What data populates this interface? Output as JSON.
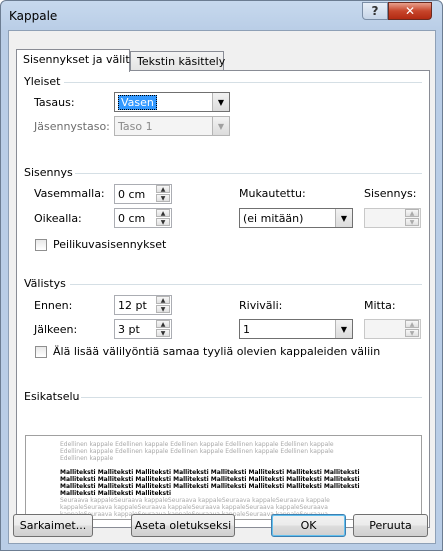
{
  "window": {
    "title": "Kappale"
  },
  "titlebar": {
    "help": "?",
    "close": "✕"
  },
  "tabs": [
    {
      "label": "Sisennykset ja välit",
      "active": true
    },
    {
      "label": "Tekstin käsittely",
      "active": false
    }
  ],
  "general": {
    "heading": "Yleiset",
    "alignment_label": "Tasaus:",
    "alignment_value": "Vasen",
    "outline_label": "Jäsennystaso:",
    "outline_value": "Taso 1"
  },
  "indent": {
    "heading": "Sisennys",
    "left_label": "Vasemmalla:",
    "left_value": "0 cm",
    "right_label": "Oikealla:",
    "right_value": "0 cm",
    "special_label": "Mukautettu:",
    "special_value": "(ei mitään)",
    "by_label": "Sisennys:",
    "by_value": "",
    "mirror_label": "Peilikuvasisennykset"
  },
  "spacing": {
    "heading": "Välistys",
    "before_label": "Ennen:",
    "before_value": "12 pt",
    "after_label": "Jälkeen:",
    "after_value": "3 pt",
    "line_label": "Riviväli:",
    "line_value": "1",
    "at_label": "Mitta:",
    "at_value": "",
    "nospace_label": "Älä lisää välilyöntiä samaa tyyliä olevien kappaleiden väliin"
  },
  "preview": {
    "heading": "Esikatselu",
    "prev_lines": [
      "Edellinen kappale Edellinen kappale Edellinen kappale Edellinen kappale Edellinen kappale",
      "Edellinen kappale Edellinen kappale Edellinen kappale Edellinen kappale Edellinen kappale",
      "Edellinen kappale"
    ],
    "sample_lines": [
      "Malliteksti Malliteksti Malliteksti Malliteksti Malliteksti Malliteksti Malliteksti Malliteksti",
      "Malliteksti Malliteksti Malliteksti Malliteksti Malliteksti Malliteksti Malliteksti Malliteksti",
      "Malliteksti Malliteksti Malliteksti Malliteksti Malliteksti Malliteksti Malliteksti Malliteksti",
      "Malliteksti Malliteksti Malliteksti"
    ],
    "next_lines": [
      "Seuraava kappaleSeuraava kappaleSeuraava kappaleSeuraava kappaleSeuraava kappale",
      "kappaleSeuraava kappaleSeuraava kappaleSeuraava kappaleSeuraava kappaleSeuraava",
      "kappaleSeuraava kappaleSeuraava kappaleSeuraava kappaleSeuraava kappaleSeuraava",
      "kappaleSeuraava kappaleSeuraava kappaleSeuraava kappaleSeuraava kappaleSeuraava"
    ]
  },
  "buttons": {
    "tabs": "Sarkaimet...",
    "set_default": "Aseta oletukseksi",
    "ok": "OK",
    "cancel": "Peruuta"
  }
}
